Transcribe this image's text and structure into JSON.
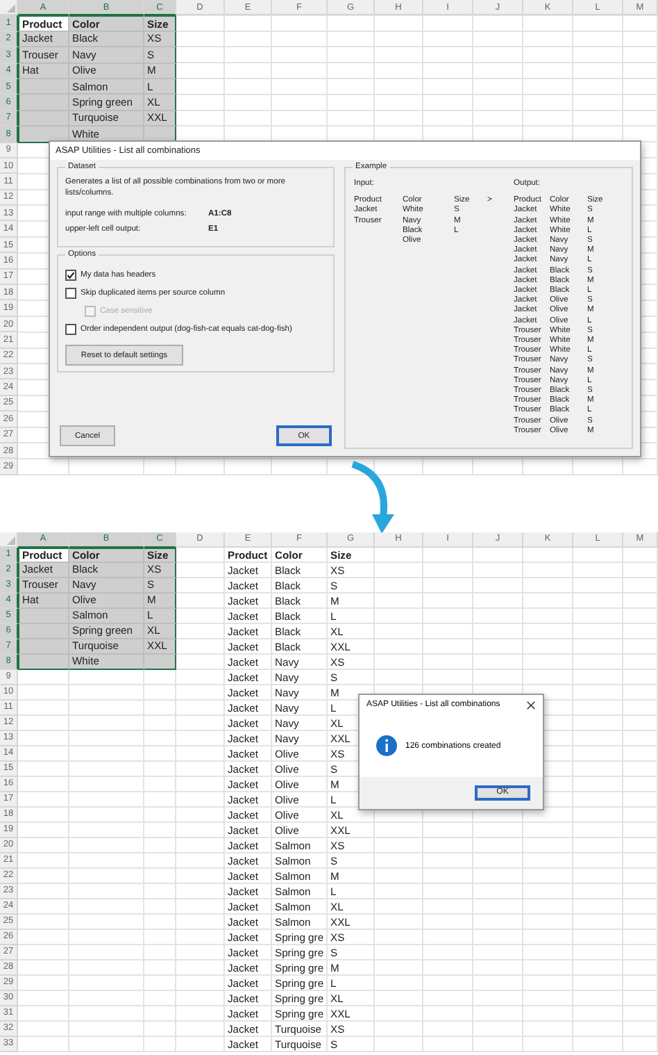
{
  "top_sheet": {
    "columns": [
      {
        "label": "A",
        "selected": true
      },
      {
        "label": "B",
        "selected": true
      },
      {
        "label": "C",
        "selected": true
      },
      {
        "label": "D",
        "selected": false
      },
      {
        "label": "E",
        "selected": false
      },
      {
        "label": "F",
        "selected": false
      },
      {
        "label": "G",
        "selected": false
      },
      {
        "label": "H",
        "selected": false
      },
      {
        "label": "I",
        "selected": false
      },
      {
        "label": "J",
        "selected": false
      },
      {
        "label": "K",
        "selected": false
      },
      {
        "label": "L",
        "selected": false
      },
      {
        "label": "M",
        "selected": false
      }
    ],
    "rows": [
      {
        "number": "1",
        "selected": true,
        "active": true,
        "header": true,
        "column_a": "Product",
        "column_b": "Color",
        "column_c": "Size"
      },
      {
        "number": "2",
        "selected": true,
        "column_a": "Jacket",
        "column_b": "Black",
        "column_c": "XS"
      },
      {
        "number": "3",
        "selected": true,
        "column_a": "Trouser",
        "column_b": "Navy",
        "column_c": "S"
      },
      {
        "number": "4",
        "selected": true,
        "column_a": "Hat",
        "column_b": "Olive",
        "column_c": "M"
      },
      {
        "number": "5",
        "selected": true,
        "column_b": "Salmon",
        "column_c": "L"
      },
      {
        "number": "6",
        "selected": true,
        "column_b": "Spring green",
        "column_c": "XL"
      },
      {
        "number": "7",
        "selected": true,
        "column_b": "Turquoise",
        "column_c": "XXL"
      },
      {
        "number": "8",
        "selected": true,
        "column_b": "White"
      },
      {
        "number": "9",
        "selected": false
      },
      {
        "number": "10",
        "selected": false
      },
      {
        "number": "11",
        "selected": false
      },
      {
        "number": "12",
        "selected": false
      },
      {
        "number": "13",
        "selected": false
      },
      {
        "number": "14",
        "selected": false
      },
      {
        "number": "15",
        "selected": false
      },
      {
        "number": "16",
        "selected": false
      },
      {
        "number": "17",
        "selected": false
      },
      {
        "number": "18",
        "selected": false
      },
      {
        "number": "19",
        "selected": false
      },
      {
        "number": "20",
        "selected": false
      },
      {
        "number": "21",
        "selected": false
      },
      {
        "number": "22",
        "selected": false
      },
      {
        "number": "23",
        "selected": false
      },
      {
        "number": "24",
        "selected": false
      },
      {
        "number": "25",
        "selected": false
      },
      {
        "number": "26",
        "selected": false
      },
      {
        "number": "27",
        "selected": false
      },
      {
        "number": "28",
        "selected": false
      },
      {
        "number": "29",
        "selected": false
      }
    ]
  },
  "dialog": {
    "title": "ASAP Utilities - List all combinations",
    "dataset": {
      "legend": "Dataset",
      "description": "Generates a list of all possible combinations from two or more lists/columns.",
      "fields": [
        {
          "label": "input range with multiple columns:",
          "value": "A1:C8"
        },
        {
          "label": "upper-left cell output:",
          "value": "E1"
        }
      ]
    },
    "options": {
      "legend": "Options",
      "checkboxes": [
        {
          "label": "My data has headers",
          "checked": true,
          "disabled": false
        },
        {
          "label": "Skip duplicated items per source column",
          "checked": false,
          "disabled": false,
          "children": [
            {
              "label": "Case sensitive",
              "checked": false,
              "disabled": true
            }
          ]
        },
        {
          "label": "Order independent output (dog-fish-cat equals cat-dog-fish)",
          "checked": false,
          "disabled": false
        }
      ],
      "reset_button": "Reset to default settings"
    },
    "example": {
      "legend": "Example",
      "input_label": "Input:",
      "output_label": "Output:",
      "arrow": ">",
      "input_columns": [
        [
          "Product",
          "Jacket",
          "Trouser"
        ],
        [
          "Color",
          "White",
          "Navy",
          "Black",
          "Olive"
        ],
        [
          "Size",
          "S",
          "M",
          "L"
        ]
      ],
      "output_rows": [
        [
          "Product",
          "Color",
          "Size"
        ],
        [
          "Jacket",
          "White",
          "S"
        ],
        [
          "Jacket",
          "White",
          "M"
        ],
        [
          "Jacket",
          "White",
          "L"
        ],
        [
          "Jacket",
          "Navy",
          "S"
        ],
        [
          "Jacket",
          "Navy",
          "M"
        ],
        [
          "Jacket",
          "Navy",
          "L"
        ],
        [
          "Jacket",
          "Black",
          "S"
        ],
        [
          "Jacket",
          "Black",
          "M"
        ],
        [
          "Jacket",
          "Black",
          "L"
        ],
        [
          "Jacket",
          "Olive",
          "S"
        ],
        [
          "Jacket",
          "Olive",
          "M"
        ],
        [
          "Jacket",
          "Olive",
          "L"
        ],
        [
          "Trouser",
          "White",
          "S"
        ],
        [
          "Trouser",
          "White",
          "M"
        ],
        [
          "Trouser",
          "White",
          "L"
        ],
        [
          "Trouser",
          "Navy",
          "S"
        ],
        [
          "Trouser",
          "Navy",
          "M"
        ],
        [
          "Trouser",
          "Navy",
          "L"
        ],
        [
          "Trouser",
          "Black",
          "S"
        ],
        [
          "Trouser",
          "Black",
          "M"
        ],
        [
          "Trouser",
          "Black",
          "L"
        ],
        [
          "Trouser",
          "Olive",
          "S"
        ],
        [
          "Trouser",
          "Olive",
          "M"
        ]
      ]
    },
    "cancel_button": "Cancel",
    "ok_button": "OK"
  },
  "bottom_sheet": {
    "columns": [
      {
        "label": "A",
        "selected": true
      },
      {
        "label": "B",
        "selected": true
      },
      {
        "label": "C",
        "selected": true
      },
      {
        "label": "D",
        "selected": false
      },
      {
        "label": "E",
        "selected": false
      },
      {
        "label": "F",
        "selected": false
      },
      {
        "label": "G",
        "selected": false
      },
      {
        "label": "H",
        "selected": false
      },
      {
        "label": "I",
        "selected": false
      },
      {
        "label": "J",
        "selected": false
      },
      {
        "label": "K",
        "selected": false
      },
      {
        "label": "L",
        "selected": false
      },
      {
        "label": "M",
        "selected": false
      }
    ],
    "rows": [
      {
        "number": "1",
        "selected": true,
        "active": true,
        "header": true,
        "column_a": "Product",
        "column_b": "Color",
        "column_c": "Size",
        "column_e": "Product",
        "column_f": "Color",
        "column_g": "Size"
      },
      {
        "number": "2",
        "selected": true,
        "column_a": "Jacket",
        "column_b": "Black",
        "column_c": "XS",
        "column_e": "Jacket",
        "column_f": "Black",
        "column_g": "XS"
      },
      {
        "number": "3",
        "selected": true,
        "column_a": "Trouser",
        "column_b": "Navy",
        "column_c": "S",
        "column_e": "Jacket",
        "column_f": "Black",
        "column_g": "S"
      },
      {
        "number": "4",
        "selected": true,
        "column_a": "Hat",
        "column_b": "Olive",
        "column_c": "M",
        "column_e": "Jacket",
        "column_f": "Black",
        "column_g": "M"
      },
      {
        "number": "5",
        "selected": true,
        "column_b": "Salmon",
        "column_c": "L",
        "column_e": "Jacket",
        "column_f": "Black",
        "column_g": "L"
      },
      {
        "number": "6",
        "selected": true,
        "column_b": "Spring green",
        "column_c": "XL",
        "column_e": "Jacket",
        "column_f": "Black",
        "column_g": "XL"
      },
      {
        "number": "7",
        "selected": true,
        "column_b": "Turquoise",
        "column_c": "XXL",
        "column_e": "Jacket",
        "column_f": "Black",
        "column_g": "XXL"
      },
      {
        "number": "8",
        "selected": true,
        "column_b": "White",
        "column_e": "Jacket",
        "column_f": "Navy",
        "column_g": "XS"
      },
      {
        "number": "9",
        "selected": false,
        "column_e": "Jacket",
        "column_f": "Navy",
        "column_g": "S"
      },
      {
        "number": "10",
        "selected": false,
        "column_e": "Jacket",
        "column_f": "Navy",
        "column_g": "M"
      },
      {
        "number": "11",
        "selected": false,
        "column_e": "Jacket",
        "column_f": "Navy",
        "column_g": "L"
      },
      {
        "number": "12",
        "selected": false,
        "column_e": "Jacket",
        "column_f": "Navy",
        "column_g": "XL"
      },
      {
        "number": "13",
        "selected": false,
        "column_e": "Jacket",
        "column_f": "Navy",
        "column_g": "XXL"
      },
      {
        "number": "14",
        "selected": false,
        "column_e": "Jacket",
        "column_f": "Olive",
        "column_g": "XS"
      },
      {
        "number": "15",
        "selected": false,
        "column_e": "Jacket",
        "column_f": "Olive",
        "column_g": "S"
      },
      {
        "number": "16",
        "selected": false,
        "column_e": "Jacket",
        "column_f": "Olive",
        "column_g": "M"
      },
      {
        "number": "17",
        "selected": false,
        "column_e": "Jacket",
        "column_f": "Olive",
        "column_g": "L"
      },
      {
        "number": "18",
        "selected": false,
        "column_e": "Jacket",
        "column_f": "Olive",
        "column_g": "XL"
      },
      {
        "number": "19",
        "selected": false,
        "column_e": "Jacket",
        "column_f": "Olive",
        "column_g": "XXL"
      },
      {
        "number": "20",
        "selected": false,
        "column_e": "Jacket",
        "column_f": "Salmon",
        "column_g": "XS"
      },
      {
        "number": "21",
        "selected": false,
        "column_e": "Jacket",
        "column_f": "Salmon",
        "column_g": "S"
      },
      {
        "number": "22",
        "selected": false,
        "column_e": "Jacket",
        "column_f": "Salmon",
        "column_g": "M"
      },
      {
        "number": "23",
        "selected": false,
        "column_e": "Jacket",
        "column_f": "Salmon",
        "column_g": "L"
      },
      {
        "number": "24",
        "selected": false,
        "column_e": "Jacket",
        "column_f": "Salmon",
        "column_g": "XL"
      },
      {
        "number": "25",
        "selected": false,
        "column_e": "Jacket",
        "column_f": "Salmon",
        "column_g": "XXL"
      },
      {
        "number": "26",
        "selected": false,
        "column_e": "Jacket",
        "column_f": "Spring gre",
        "column_g": "XS"
      },
      {
        "number": "27",
        "selected": false,
        "column_e": "Jacket",
        "column_f": "Spring gre",
        "column_g": "S"
      },
      {
        "number": "28",
        "selected": false,
        "column_e": "Jacket",
        "column_f": "Spring gre",
        "column_g": "M"
      },
      {
        "number": "29",
        "selected": false,
        "column_e": "Jacket",
        "column_f": "Spring gre",
        "column_g": "L"
      },
      {
        "number": "30",
        "selected": false,
        "column_e": "Jacket",
        "column_f": "Spring gre",
        "column_g": "XL"
      },
      {
        "number": "31",
        "selected": false,
        "column_e": "Jacket",
        "column_f": "Spring gre",
        "column_g": "XXL"
      },
      {
        "number": "32",
        "selected": false,
        "column_e": "Jacket",
        "column_f": "Turquoise",
        "column_g": "XS"
      },
      {
        "number": "33",
        "selected": false,
        "column_e": "Jacket",
        "column_f": "Turquoise",
        "column_g": "S"
      }
    ]
  },
  "message_box": {
    "title": "ASAP Utilities - List all combinations",
    "message": "126 combinations created",
    "ok_button": "OK"
  }
}
